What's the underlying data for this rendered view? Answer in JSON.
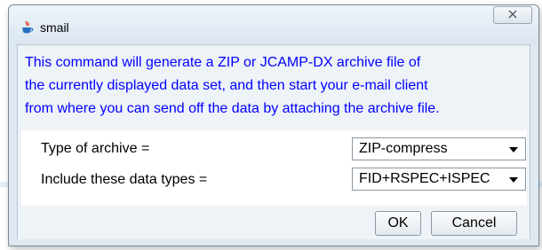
{
  "window": {
    "title": "smail",
    "icon": "java-cup-icon",
    "close_icon": "close-icon"
  },
  "message": {
    "lines": [
      "This command will generate a ZIP or JCAMP-DX archive file of",
      "the currently displayed data set, and then start your e-mail client",
      "from where you can send off the data by attaching the archive file."
    ]
  },
  "fields": {
    "archive_type": {
      "label": "Type of archive =",
      "value": "ZIP-compress"
    },
    "data_types": {
      "label": "Include these data types =",
      "value": "FID+RSPEC+ISPEC"
    }
  },
  "buttons": {
    "ok": "OK",
    "cancel": "Cancel"
  },
  "colors": {
    "message_text": "#0000ff",
    "dialog_bg": "#dfe8f1"
  }
}
